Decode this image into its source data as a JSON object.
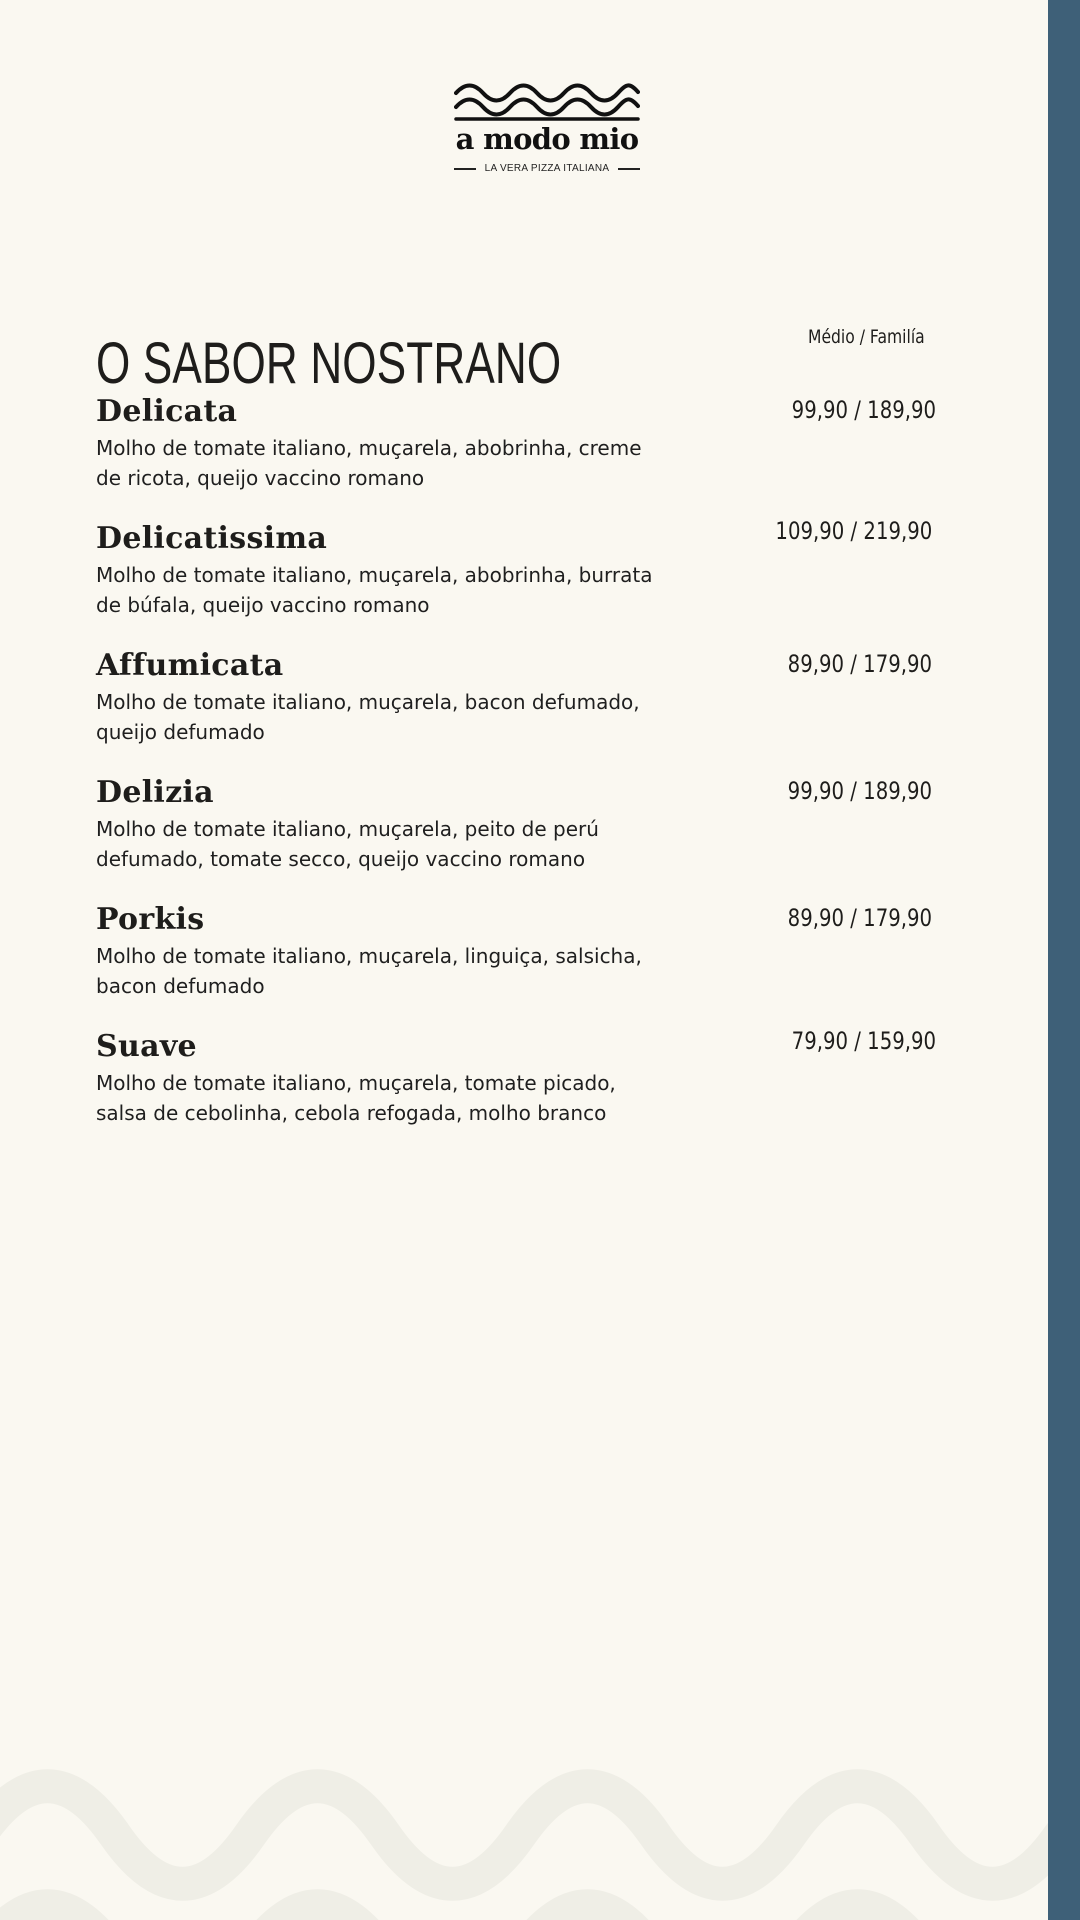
{
  "logo": {
    "name": "a modo mio",
    "tagline": "LA VERA PIZZA ITALIANA"
  },
  "menu": {
    "heading": "O SABOR NOSTRANO",
    "size_label": "Médio / Familía",
    "items": [
      {
        "name": "Delicata",
        "description": "Molho de tomate italiano, muçarela, abobrinha, creme de ricota, queijo vaccino romano",
        "price": "99,90 / 189,90"
      },
      {
        "name": "Delicatissima",
        "description": "Molho de tomate italiano, muçarela, abobrinha, burrata de búfala, queijo vaccino romano",
        "price": "109,90 / 219,90"
      },
      {
        "name": "Affumicata",
        "description": "Molho de tomate italiano, muçarela, bacon defumado, queijo defumado",
        "price": "89,90 / 179,90"
      },
      {
        "name": "Delizia",
        "description": "Molho de tomate italiano, muçarela, peito de perú defumado, tomate secco, queijo vaccino romano",
        "price": "99,90 / 189,90"
      },
      {
        "name": "Porkis",
        "description": "Molho de tomate italiano, muçarela, linguiça, salsicha, bacon defumado",
        "price": "89,90 / 179,90"
      },
      {
        "name": "Suave",
        "description": "Molho de tomate italiano, muçarela, tomate picado, salsa de cebolinha, cebola refogada, molho branco",
        "price": "79,90 / 159,90"
      }
    ]
  },
  "colors": {
    "background": "#faf8f1",
    "text": "#1e1d1b",
    "side_stripe": "#3e6078",
    "decorative_waves": "#efeee6"
  }
}
